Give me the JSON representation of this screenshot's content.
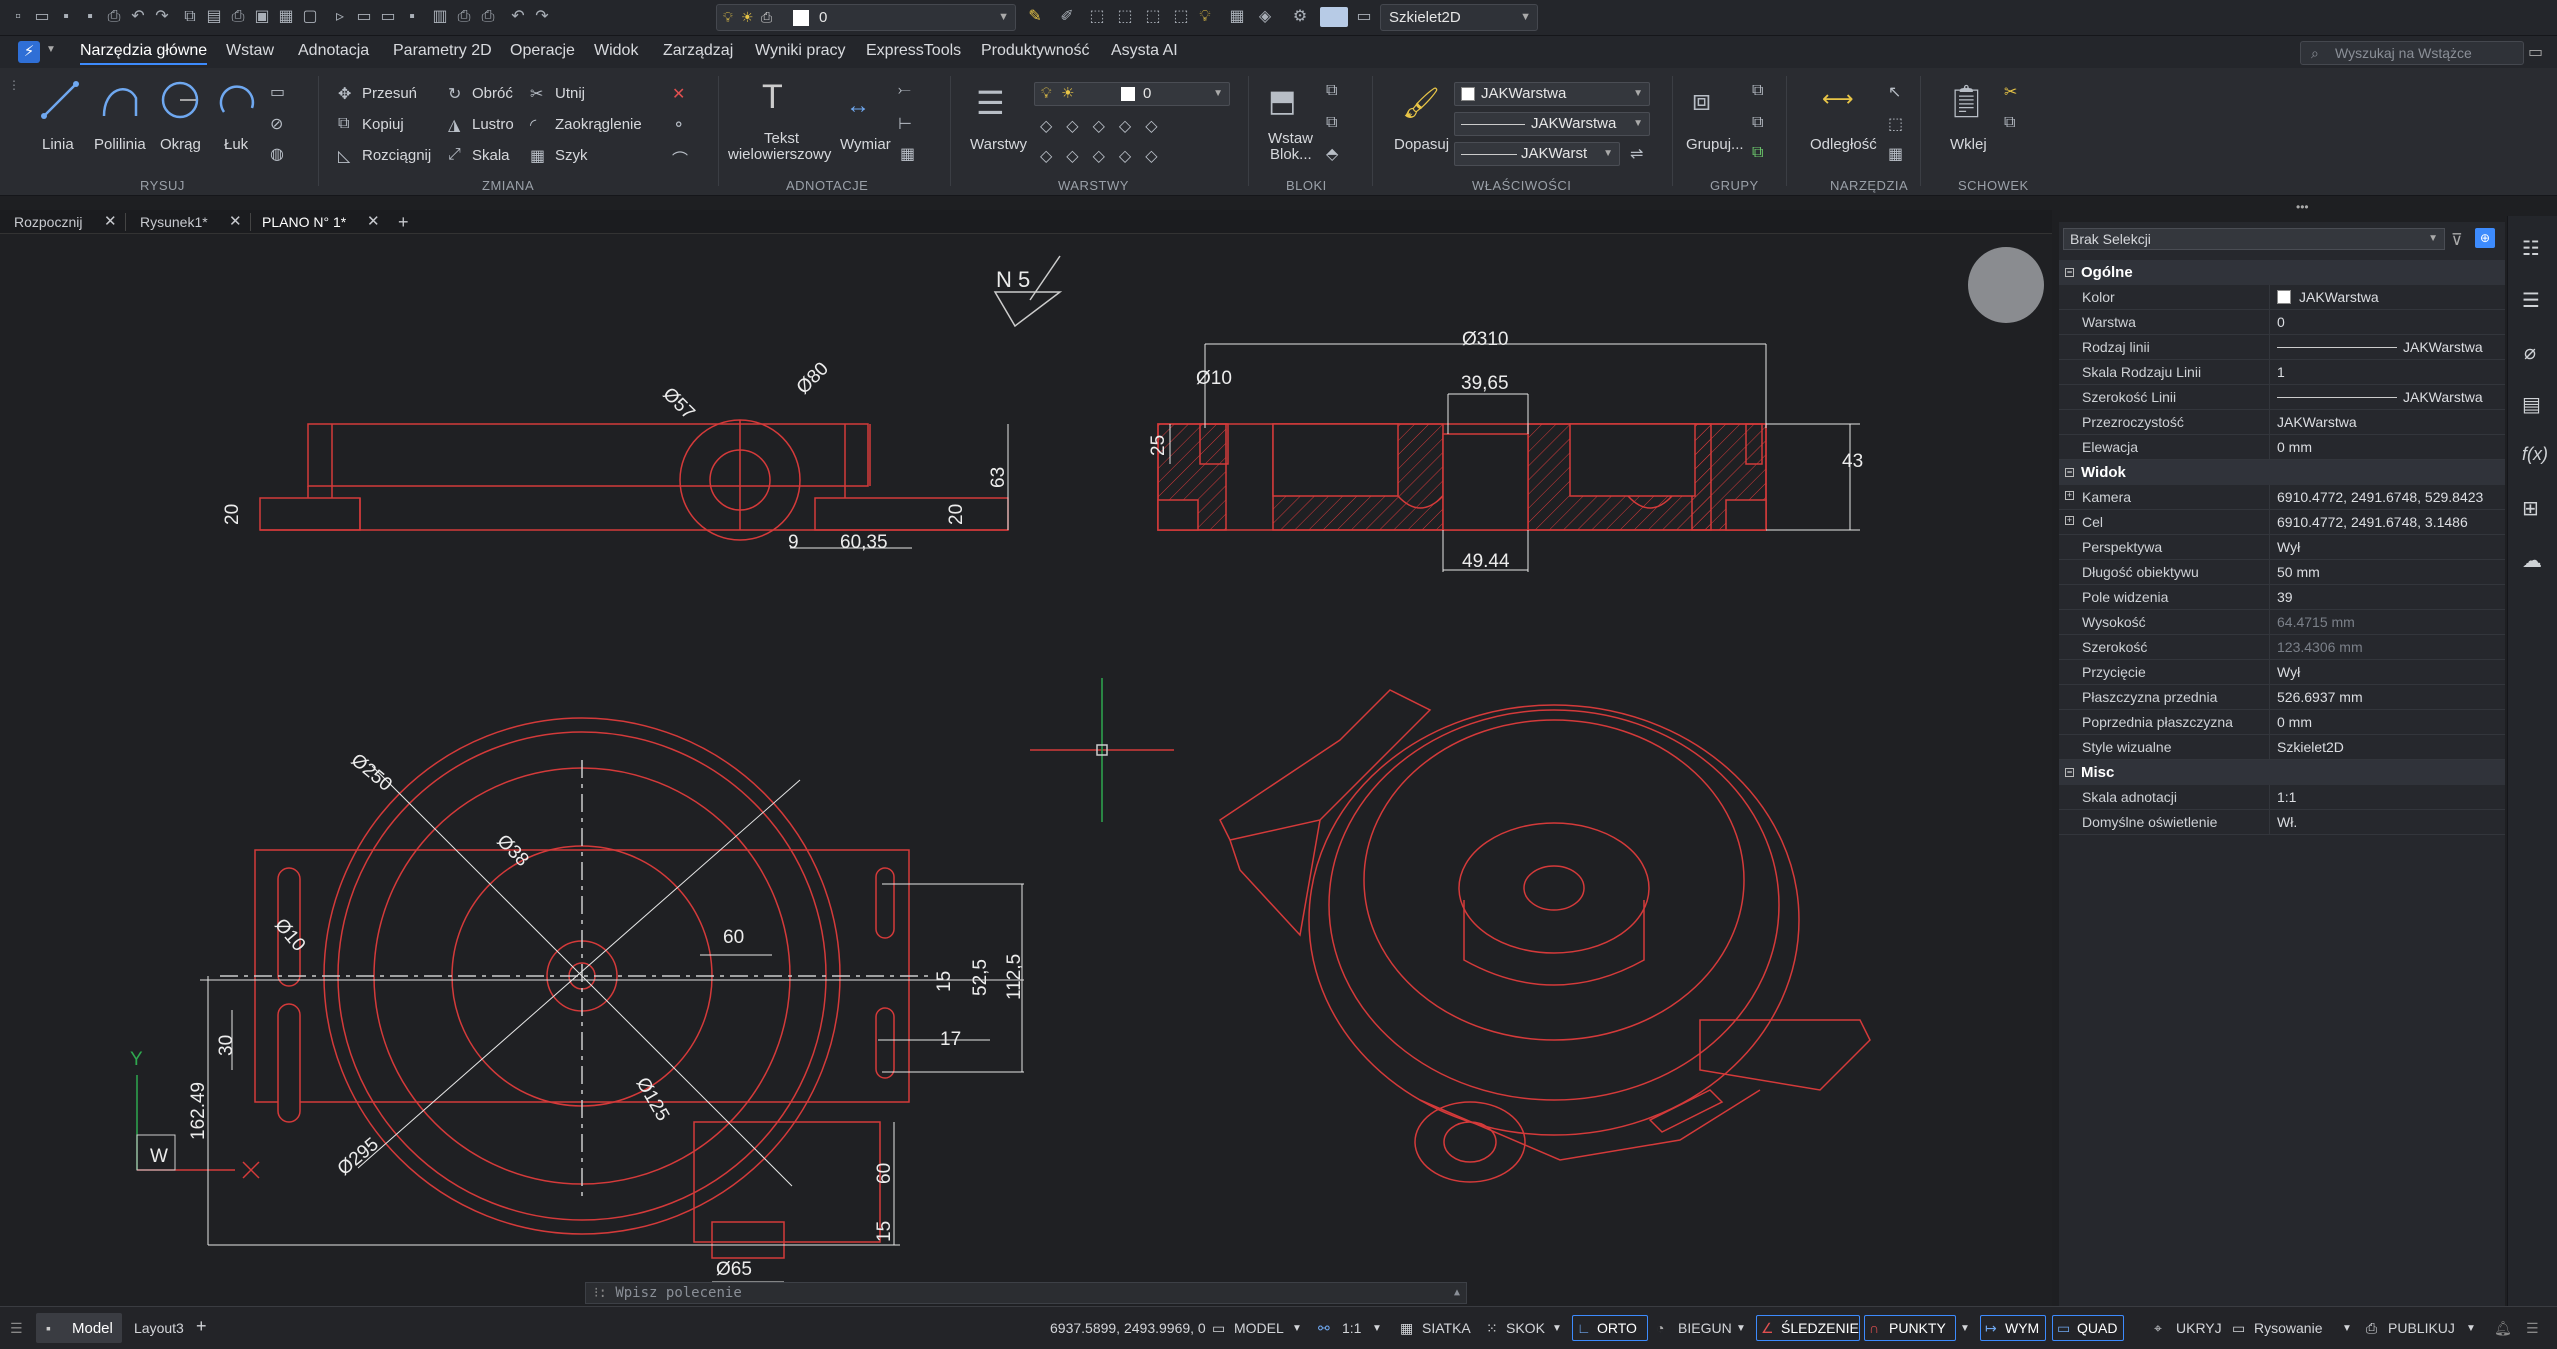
{
  "qat": {
    "layer_value": "0",
    "visual_style": "Szkielet2D"
  },
  "menu": {
    "items": [
      "Narzędzia główne",
      "Wstaw",
      "Adnotacja",
      "Parametry 2D",
      "Operacje",
      "Widok",
      "Zarządzaj",
      "Wyniki pracy",
      "ExpressTools",
      "Produktywność",
      "Asysta AI"
    ],
    "search_placeholder": "Wyszukaj na Wstążce"
  },
  "ribbon": {
    "draw": {
      "linia": "Linia",
      "polilinia": "Polilinia",
      "okrag": "Okrąg",
      "luk": "Łuk",
      "section": "RYSUJ"
    },
    "modify": {
      "przesun": "Przesuń",
      "obroc": "Obróć",
      "utnij": "Utnij",
      "kopiuj": "Kopiuj",
      "lustro": "Lustro",
      "zaokraglenie": "Zaokrąglenie",
      "rozciagnij": "Rozciągnij",
      "skala": "Skala",
      "szyk": "Szyk",
      "section": "ZMIANA"
    },
    "annot": {
      "tekst1": "Tekst",
      "tekst2": "wielowierszowy",
      "wymiar": "Wymiar",
      "section": "ADNOTACJE"
    },
    "layers": {
      "warstwy": "Warstwy",
      "layer_value": "0",
      "section": "WARSTWY"
    },
    "blocks": {
      "wstaw1": "Wstaw",
      "wstaw2": "Blok...",
      "section": "BLOKI"
    },
    "props": {
      "dopasuj": "Dopasuj",
      "color": "JAKWarstwa",
      "linetype": "JAKWarstwa",
      "lineweight": "JAKWarst",
      "section": "WŁAŚCIWOŚCI"
    },
    "groups": {
      "grupuj": "Grupuj...",
      "section": "GRUPY"
    },
    "tools": {
      "odleglosc": "Odległość",
      "section": "NARZĘDZIA"
    },
    "clipboard": {
      "wklej": "Wklej",
      "section": "SCHOWEK"
    }
  },
  "tabs": [
    "Rozpocznij",
    "Rysunek1*",
    "PLANO N° 1*"
  ],
  "drawing": {
    "title": "N 5",
    "dims": {
      "d57": "Ø57",
      "d80": "Ø80",
      "d63": "63",
      "d20a": "20",
      "d20b": "20",
      "d9": "9",
      "d6035": "60,35",
      "d310": "Ø310",
      "d10": "Ø10",
      "d3965": "39,65",
      "d25": "25",
      "d43": "43",
      "d4944": "49.44",
      "d250": "Ø250",
      "d38": "Ø38",
      "d10b": "Ø10",
      "d60": "60",
      "d15a": "15",
      "d525": "52,5",
      "d1125": "112,5",
      "d17": "17",
      "d30": "30",
      "d125": "Ø125",
      "d295": "Ø295",
      "d16249": "162.49",
      "d60b": "60",
      "d15b": "15",
      "d65": "Ø65"
    },
    "ucs": {
      "y": "Y",
      "w": "W"
    }
  },
  "command_placeholder": "Wpisz polecenie",
  "properties": {
    "selection": "Brak Selekcji",
    "sections": {
      "general": "Ogólne",
      "view": "Widok",
      "misc": "Misc"
    },
    "general": [
      {
        "name": "Kolor",
        "value": "JAKWarstwa"
      },
      {
        "name": "Warstwa",
        "value": "0"
      },
      {
        "name": "Rodzaj linii",
        "value": "JAKWarstwa"
      },
      {
        "name": "Skala Rodzaju Linii",
        "value": "1"
      },
      {
        "name": "Szerokość Linii",
        "value": "JAKWarstwa"
      },
      {
        "name": "Przezroczystość",
        "value": "JAKWarstwa"
      },
      {
        "name": "Elewacja",
        "value": "0 mm"
      }
    ],
    "view": [
      {
        "name": "Kamera",
        "value": "6910.4772, 2491.6748, 529.8423"
      },
      {
        "name": "Cel",
        "value": "6910.4772, 2491.6748, 3.1486"
      },
      {
        "name": "Perspektywa",
        "value": "Wył"
      },
      {
        "name": "Długość obiektywu",
        "value": "50 mm"
      },
      {
        "name": "Pole widzenia",
        "value": "39"
      },
      {
        "name": "Wysokość",
        "value": "64.4715 mm"
      },
      {
        "name": "Szerokość",
        "value": "123.4306 mm"
      },
      {
        "name": "Przycięcie",
        "value": "Wył"
      },
      {
        "name": "Płaszczyzna przednia",
        "value": "526.6937 mm"
      },
      {
        "name": "Poprzednia płaszczyzna",
        "value": "0 mm"
      },
      {
        "name": "Style wizualne",
        "value": "Szkielet2D"
      }
    ],
    "misc": [
      {
        "name": "Skala adnotacji",
        "value": "1:1"
      },
      {
        "name": "Domyślne oświetlenie",
        "value": "Wł."
      }
    ]
  },
  "status": {
    "model_tab": "Model",
    "layout_tab": "Layout3",
    "coords": "6937.5899, 2493.9969, 0",
    "model": "MODEL",
    "scale": "1:1",
    "siatka": "SIATKA",
    "skok": "SKOK",
    "orto": "ORTO",
    "biegun": "BIEGUN",
    "sledzenie": "ŚLEDZENIE",
    "punkty": "PUNKTY",
    "wym": "WYM",
    "quad": "QUAD",
    "ukryj": "UKRYJ",
    "rysowanie": "Rysowanie",
    "publikuj": "PUBLIKUJ"
  }
}
